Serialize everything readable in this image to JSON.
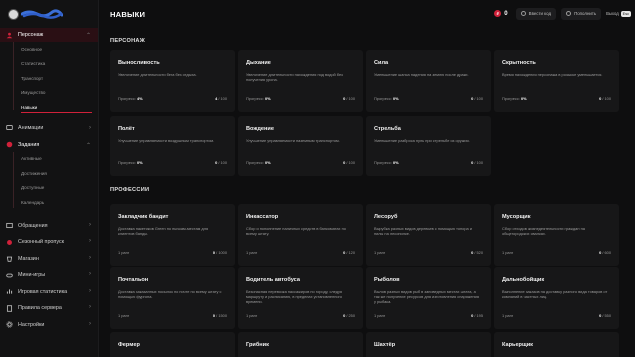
{
  "header": {
    "title": "НАВЫКИ",
    "currency_value": "0",
    "enter_code_label": "Ввести код",
    "topup_label": "Пополнить",
    "exit_label": "Выход",
    "exit_key": "Esc"
  },
  "sidebar": {
    "sections": [
      {
        "label": "Персонаж",
        "icon": "user-icon",
        "expanded": true,
        "active": true,
        "items": [
          "Основное",
          "Статистика",
          "Транспорт",
          "Имущество",
          "Навыки"
        ],
        "selected": "Навыки"
      },
      {
        "label": "Анимации",
        "icon": "animation-icon",
        "expanded": false
      },
      {
        "label": "Задания",
        "icon": "tasks-icon",
        "expanded": true,
        "items": [
          "Активные",
          "Достижения",
          "Доступные",
          "Календарь"
        ]
      },
      {
        "label": "Обращения",
        "icon": "ticket-icon",
        "expanded": false
      },
      {
        "label": "Сезонный пропуск",
        "icon": "pass-icon",
        "expanded": false
      },
      {
        "label": "Магазин",
        "icon": "shop-icon",
        "expanded": false
      },
      {
        "label": "Мини-игры",
        "icon": "gamepad-icon",
        "expanded": false
      },
      {
        "label": "Игровая статистика",
        "icon": "chart-icon",
        "expanded": false
      },
      {
        "label": "Правила сервера",
        "icon": "rules-icon",
        "expanded": false
      },
      {
        "label": "Настройки",
        "icon": "gear-icon",
        "expanded": false
      }
    ]
  },
  "sections": {
    "character": {
      "title": "ПЕРСОНАЖ",
      "cards": [
        {
          "name": "Выносливость",
          "desc": "Увеличение длительности бега без отдыха.",
          "progress_label": "Прогресс:",
          "progress": "4%",
          "count_value": "4",
          "count_max": "/ 100"
        },
        {
          "name": "Дыхание",
          "desc": "Увеличение длительности нахождения под водой без получения урона.",
          "progress_label": "Прогресс:",
          "progress": "0%",
          "count_value": "0",
          "count_max": "/ 100"
        },
        {
          "name": "Сила",
          "desc": "Уменьшение шанса падения на землю после драки.",
          "progress_label": "Прогресс:",
          "progress": "0%",
          "count_value": "0",
          "count_max": "/ 100"
        },
        {
          "name": "Скрытность",
          "desc": "Время нахождения персонажа в розыске уменьшается.",
          "progress_label": "Прогресс:",
          "progress": "0%",
          "count_value": "0",
          "count_max": "/ 100"
        },
        {
          "name": "Полёт",
          "desc": "Улучшение управляемости воздушным транспортом.",
          "progress_label": "Прогресс:",
          "progress": "0%",
          "count_value": "0",
          "count_max": "/ 100"
        },
        {
          "name": "Вождение",
          "desc": "Улучшение управляемости наземным транспортом.",
          "progress_label": "Прогресс:",
          "progress": "0%",
          "count_value": "0",
          "count_max": "/ 100"
        },
        {
          "name": "Стрельба",
          "desc": "Уменьшение разброса пуль при стрельбе из оружия.",
          "progress_label": "Прогресс:",
          "progress": "0%",
          "count_value": "0",
          "count_max": "/ 100"
        }
      ]
    },
    "professions": {
      "title": "ПРОФЕССИИ",
      "cards": [
        {
          "name": "Закладчик бандит",
          "desc": "Доставка пакетиков Green по нычкам-местам для клиентов банды.",
          "progress_label": "1 ранг",
          "progress": "",
          "count_value": "0",
          "count_max": "/ 1000"
        },
        {
          "name": "Инкассатор",
          "desc": "Сбор и пополнение наличных средств в банкоматах по всему штату.",
          "progress_label": "1 ранг",
          "progress": "",
          "count_value": "0",
          "count_max": "/ 120"
        },
        {
          "name": "Лесоруб",
          "desc": "Вырубка разных видов деревьев с помощью топора и пилы на лесопилке.",
          "progress_label": "1 ранг",
          "progress": "",
          "count_value": "0",
          "count_max": "/ 520"
        },
        {
          "name": "Мусорщик",
          "desc": "Сбор отходов жизнедеятельности граждан на общегородских свалках.",
          "progress_label": "1 ранг",
          "progress": "",
          "count_value": "0",
          "count_max": "/ 600"
        },
        {
          "name": "Почтальон",
          "desc": "Доставка заказанных посылок по почте по всему штату с помощью фургона.",
          "progress_label": "1 ранг",
          "progress": "",
          "count_value": "0",
          "count_max": "/ 1500"
        },
        {
          "name": "Водитель автобуса",
          "desc": "Безопасная перевозка пассажиров по городу, следуя маршруту и расписанию, в пределах установленного времени.",
          "progress_label": "1 ранг",
          "progress": "",
          "count_value": "0",
          "count_max": "/ 250"
        },
        {
          "name": "Рыболов",
          "desc": "Вылов разных видов рыб в заповедных местах штата, а так же получение ресурсов для изготовления снаряжения у рыбака.",
          "progress_label": "1 ранг",
          "progress": "",
          "count_value": "0",
          "count_max": "/ 195"
        },
        {
          "name": "Дальнобойщик",
          "desc": "Выполнение заказов на доставку разного вида товаров от компаний в частных лиц.",
          "progress_label": "1 ранг",
          "progress": "",
          "count_value": "0",
          "count_max": "/ 550"
        },
        {
          "name": "Фермер",
          "desc": "",
          "progress_label": "",
          "progress": "",
          "count_value": "",
          "count_max": ""
        },
        {
          "name": "Грибник",
          "desc": "",
          "progress_label": "",
          "progress": "",
          "count_value": "",
          "count_max": ""
        },
        {
          "name": "Шахтёр",
          "desc": "",
          "progress_label": "",
          "progress": "",
          "count_value": "",
          "count_max": ""
        },
        {
          "name": "Карьерщик",
          "desc": "",
          "progress_label": "",
          "progress": "",
          "count_value": "",
          "count_max": ""
        }
      ]
    }
  },
  "colors": {
    "accent": "#d0213a",
    "background": "#0e0e0f",
    "card": "#171718"
  }
}
